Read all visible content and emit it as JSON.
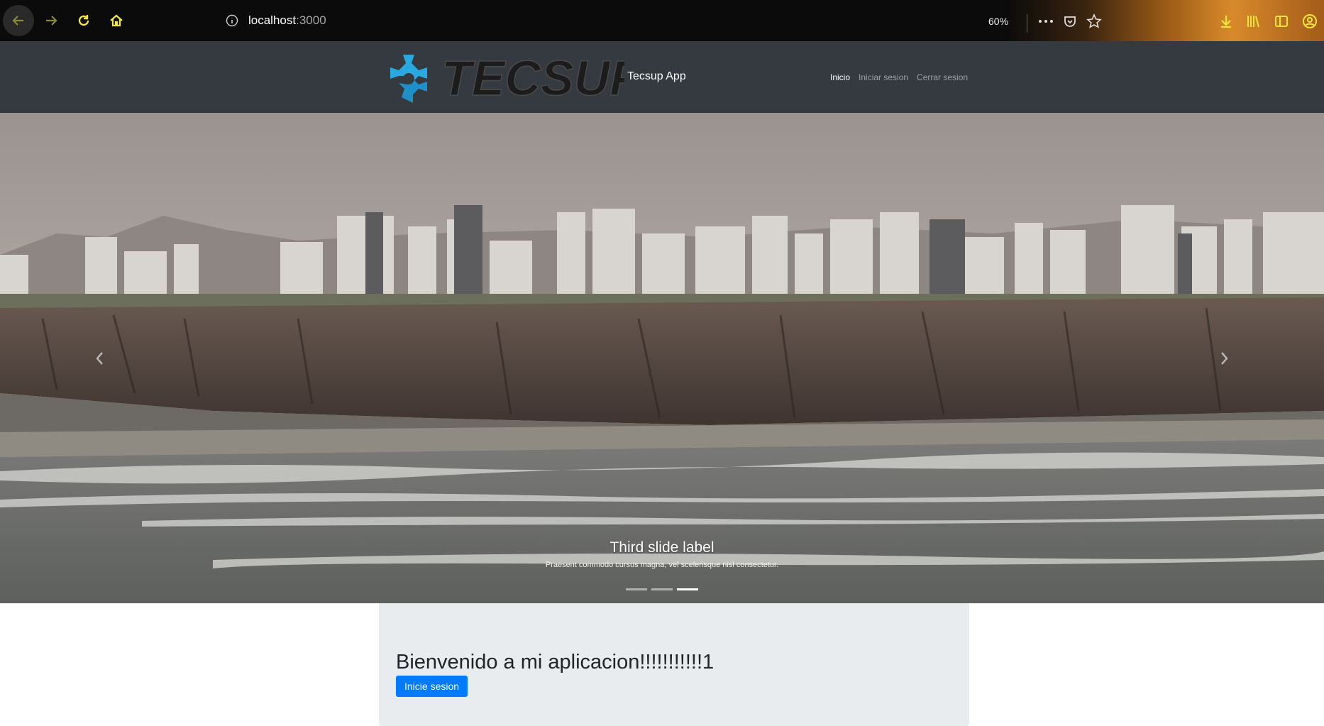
{
  "browser": {
    "url_host": "localhost",
    "url_port": ":3000",
    "zoom": "60%",
    "icons": [
      "back-icon",
      "forward-icon",
      "reload-icon",
      "home-icon",
      "info-icon",
      "more-icon",
      "pocket-icon",
      "bookmark-star-icon",
      "download-icon",
      "library-icon",
      "sidebar-icon",
      "account-icon"
    ]
  },
  "navbar": {
    "brand_name": "Tecsup App",
    "logo_text": "TECSUP",
    "links": [
      {
        "label": "Inicio",
        "active": true
      },
      {
        "label": "Iniciar sesion",
        "active": false
      },
      {
        "label": "Cerrar sesion",
        "active": false
      }
    ]
  },
  "carousel": {
    "caption_title": "Third slide label",
    "caption_text": "Praesent commodo cursus magna, vel scelerisque nisl consectetur.",
    "slide_count": 3,
    "active_slide": 3
  },
  "jumbotron": {
    "title": "Bienvenido a mi aplicacion!!!!!!!!!!!1",
    "button_label": "Inicie sesion"
  },
  "colors": {
    "navbar_bg": "#343a40",
    "jumbotron_bg": "#e9ecef",
    "primary": "#007bff",
    "logo_blue": "#29a9e0"
  }
}
